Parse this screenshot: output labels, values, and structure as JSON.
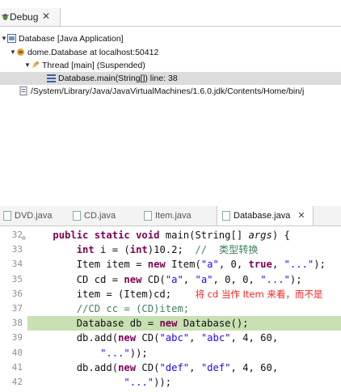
{
  "debug": {
    "tab_label": "Debug",
    "close_glyph": "✕",
    "tree": [
      {
        "text": "Database [Java Application]",
        "icon": "java-app-icon",
        "expanded": true
      },
      {
        "text": "dome.Database at localhost:50412",
        "icon": "vm-icon",
        "expanded": true
      },
      {
        "text": "Thread [main] (Suspended)",
        "icon": "thread-icon",
        "expanded": true
      },
      {
        "text": "Database.main(String[]) line: 38",
        "icon": "stack-frame-icon",
        "expanded": false
      },
      {
        "text": "/System/Library/Java/JavaVirtualMachines/1.6.0.jdk/Contents/Home/bin/j",
        "icon": "process-icon",
        "expanded": false
      }
    ]
  },
  "editor": {
    "tabs": [
      {
        "label": "DVD.java",
        "active": false
      },
      {
        "label": "CD.java",
        "active": false
      },
      {
        "label": "Item.java",
        "active": false
      },
      {
        "label": "Database.java",
        "active": true
      }
    ],
    "active_close_glyph": "✕",
    "highlight_color": "#c8e0b2",
    "lines": [
      {
        "num": "32",
        "fold": "⊖",
        "segments": [
          {
            "t": "    "
          },
          {
            "t": "public static void",
            "c": "kw"
          },
          {
            "t": " main(String[] "
          },
          {
            "t": "args",
            "c": "it"
          },
          {
            "t": ") {"
          }
        ]
      },
      {
        "num": "33",
        "segments": [
          {
            "t": "        "
          },
          {
            "t": "int",
            "c": "kw"
          },
          {
            "t": " i = ("
          },
          {
            "t": "int",
            "c": "kw"
          },
          {
            "t": ")10.2;  "
          },
          {
            "t": "//  类型转换",
            "c": "cm"
          }
        ]
      },
      {
        "num": "34",
        "segments": [
          {
            "t": "        Item item = "
          },
          {
            "t": "new",
            "c": "kw"
          },
          {
            "t": " Item("
          },
          {
            "t": "\"a\"",
            "c": "str"
          },
          {
            "t": ", 0, "
          },
          {
            "t": "true",
            "c": "kw"
          },
          {
            "t": ", "
          },
          {
            "t": "\"...\"",
            "c": "str"
          },
          {
            "t": ");"
          }
        ]
      },
      {
        "num": "35",
        "segments": [
          {
            "t": "        CD cd = "
          },
          {
            "t": "new",
            "c": "kw"
          },
          {
            "t": " CD("
          },
          {
            "t": "\"a\"",
            "c": "str"
          },
          {
            "t": ", "
          },
          {
            "t": "\"a\"",
            "c": "str"
          },
          {
            "t": ", 0, 0, "
          },
          {
            "t": "\"...\"",
            "c": "str"
          },
          {
            "t": ");"
          }
        ]
      },
      {
        "num": "36",
        "segments": [
          {
            "t": "        item = (Item)cd;    "
          },
          {
            "t": "将 cd 当作 Item 来看，而不是",
            "c": "anno"
          }
        ]
      },
      {
        "num": "37",
        "segments": [
          {
            "t": "        "
          },
          {
            "t": "//CD cc = (CD)item;",
            "c": "cm"
          }
        ]
      },
      {
        "num": "38",
        "highlight": true,
        "segments": [
          {
            "t": "        Database db = "
          },
          {
            "t": "new",
            "c": "kw"
          },
          {
            "t": " Database();"
          }
        ]
      },
      {
        "num": "39",
        "segments": [
          {
            "t": "        db.add("
          },
          {
            "t": "new",
            "c": "kw"
          },
          {
            "t": " CD("
          },
          {
            "t": "\"abc\"",
            "c": "str"
          },
          {
            "t": ", "
          },
          {
            "t": "\"abc\"",
            "c": "str"
          },
          {
            "t": ", 4, 60,"
          }
        ]
      },
      {
        "num": "40",
        "segments": [
          {
            "t": "            "
          },
          {
            "t": "\"...\"",
            "c": "str"
          },
          {
            "t": "));"
          }
        ]
      },
      {
        "num": "41",
        "segments": [
          {
            "t": "        db.add("
          },
          {
            "t": "new",
            "c": "kw"
          },
          {
            "t": " CD("
          },
          {
            "t": "\"def\"",
            "c": "str"
          },
          {
            "t": ", "
          },
          {
            "t": "\"def\"",
            "c": "str"
          },
          {
            "t": ", 4, 60,"
          }
        ]
      },
      {
        "num": "42",
        "segments": [
          {
            "t": "                "
          },
          {
            "t": "\"...\"",
            "c": "str"
          },
          {
            "t": "));"
          }
        ]
      }
    ]
  }
}
